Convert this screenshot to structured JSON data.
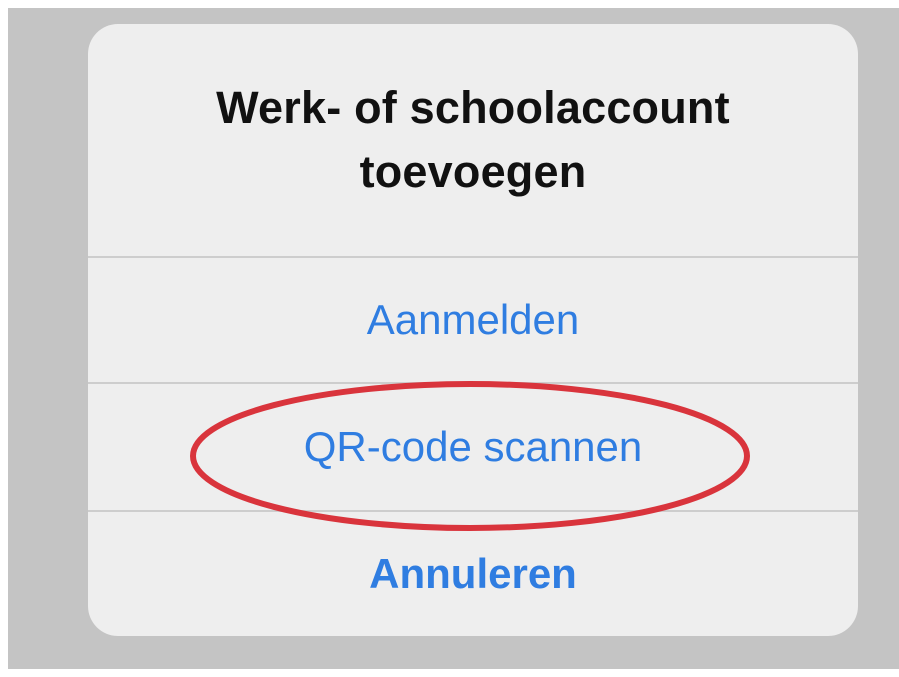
{
  "dialog": {
    "title": "Werk- of schoolaccount toevoegen",
    "actions": [
      {
        "label": "Aanmelden"
      },
      {
        "label": "QR-code scannen"
      },
      {
        "label": "Annuleren"
      }
    ]
  },
  "colors": {
    "backdrop": "#c4c4c4",
    "dialog_background": "#eeeeee",
    "title_text": "#111111",
    "action_text": "#2f7de1",
    "divider": "#cdcdcd",
    "annotation_circle": "#d9343c"
  },
  "annotation": {
    "shape": "ellipse",
    "highlights": "QR-code scannen"
  }
}
